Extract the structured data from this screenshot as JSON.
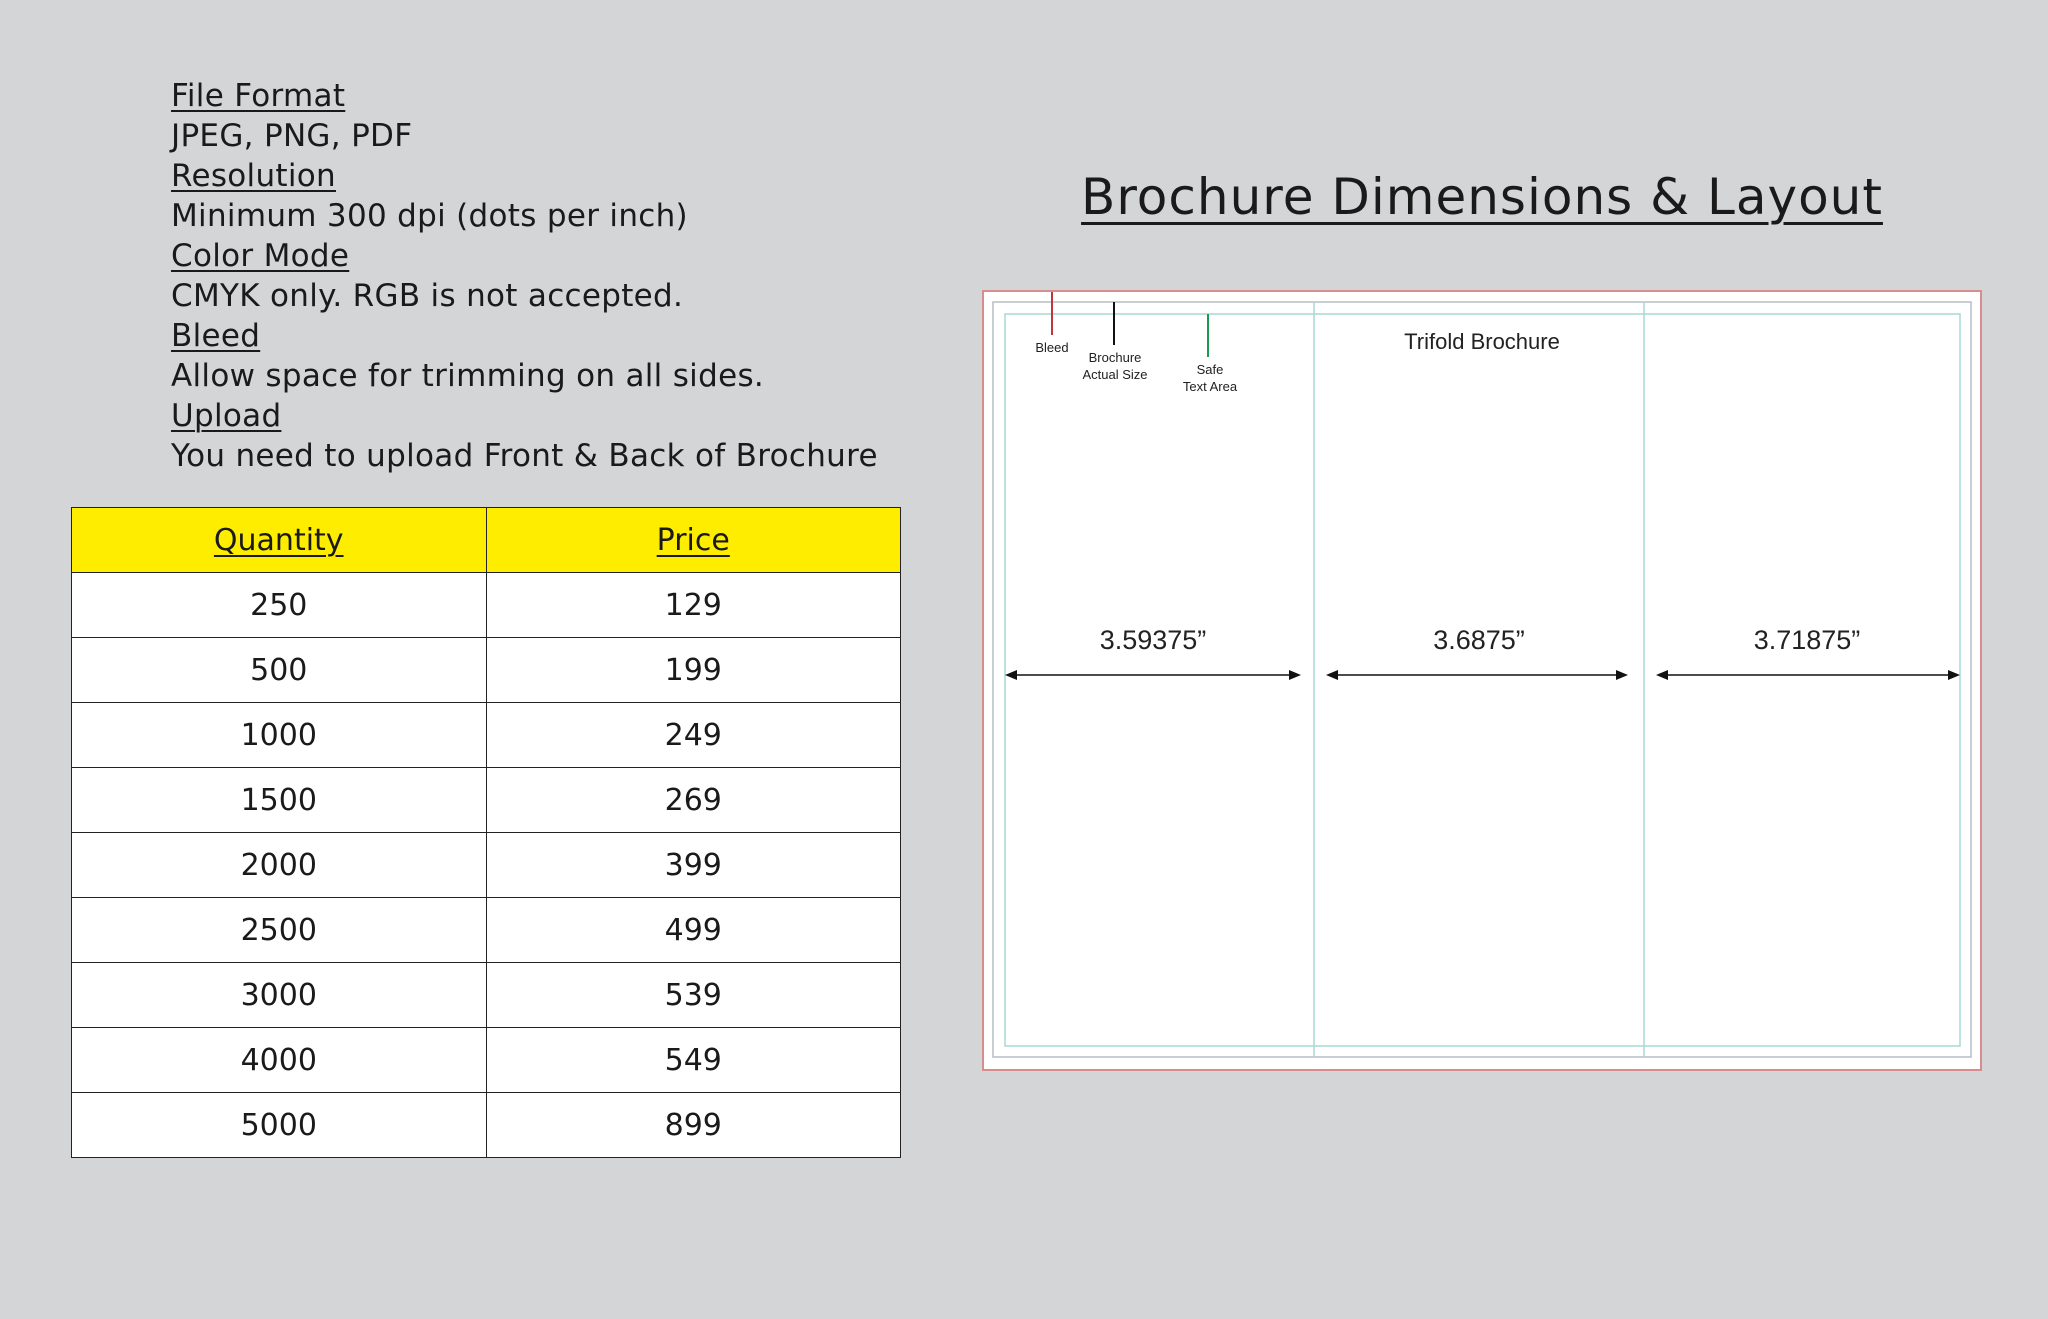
{
  "specs": [
    {
      "kind": "heading",
      "text": "File Format"
    },
    {
      "kind": "text",
      "text": "JPEG, PNG, PDF"
    },
    {
      "kind": "heading",
      "text": "Resolution"
    },
    {
      "kind": "text",
      "text": "Minimum 300 dpi (dots per inch)"
    },
    {
      "kind": "heading",
      "text": "Color Mode"
    },
    {
      "kind": "text",
      "text": "CMYK only. RGB is not accepted."
    },
    {
      "kind": "heading",
      "text": "Bleed"
    },
    {
      "kind": "text",
      "text": "Allow space for trimming on all sides."
    },
    {
      "kind": "heading",
      "text": "Upload"
    },
    {
      "kind": "text",
      "text": "You need to upload Front & Back of Brochure"
    }
  ],
  "price_table": {
    "header_color": "#ffed00",
    "columns": [
      "Quantity",
      "Price"
    ],
    "rows": [
      [
        "250",
        "129"
      ],
      [
        "500",
        "199"
      ],
      [
        "1000",
        "249"
      ],
      [
        "1500",
        "269"
      ],
      [
        "2000",
        "399"
      ],
      [
        "2500",
        "499"
      ],
      [
        "3000",
        "539"
      ],
      [
        "4000",
        "549"
      ],
      [
        "5000",
        "899"
      ]
    ]
  },
  "layout": {
    "title": "Brochure Dimensions & Layout",
    "diagram_title": "Trifold Brochure",
    "legend": {
      "bleed": "Bleed",
      "actual_size_line1": "Brochure",
      "actual_size_line2": "Actual Size",
      "safe_line1": "Safe",
      "safe_line2": "Text Area"
    },
    "panel_widths": [
      "3.59375”",
      "3.6875”",
      "3.71875”"
    ],
    "colors": {
      "bleed": "#c0363e",
      "actual_size": "#111111",
      "safe_area": "#1a9850",
      "fold_guide": "#a9d8d4",
      "outline": "#d98c8c"
    }
  }
}
